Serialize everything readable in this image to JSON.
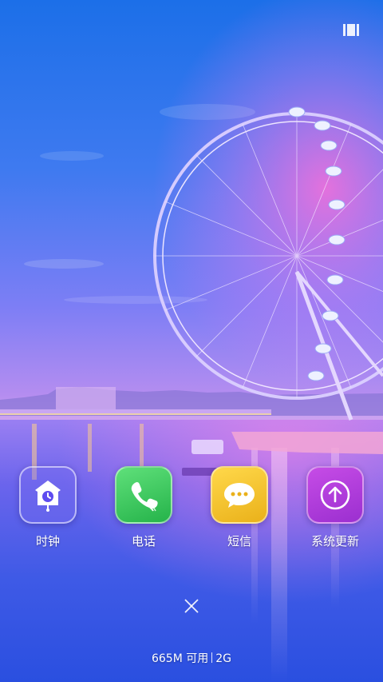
{
  "status_bar": {
    "icon": "recent-list-icon"
  },
  "apps": [
    {
      "label": "时钟",
      "icon": "cuckoo-clock-icon",
      "color": "#5e4cf0"
    },
    {
      "label": "电话",
      "icon": "phone-icon",
      "color": "#34c759"
    },
    {
      "label": "短信",
      "icon": "message-icon",
      "color": "#f2c230"
    },
    {
      "label": "系统更新",
      "icon": "upload-arrow-icon",
      "color": "#b33cd8"
    }
  ],
  "footer": {
    "close_icon": "close-icon",
    "memory": "665M 可用",
    "network": "2G"
  }
}
